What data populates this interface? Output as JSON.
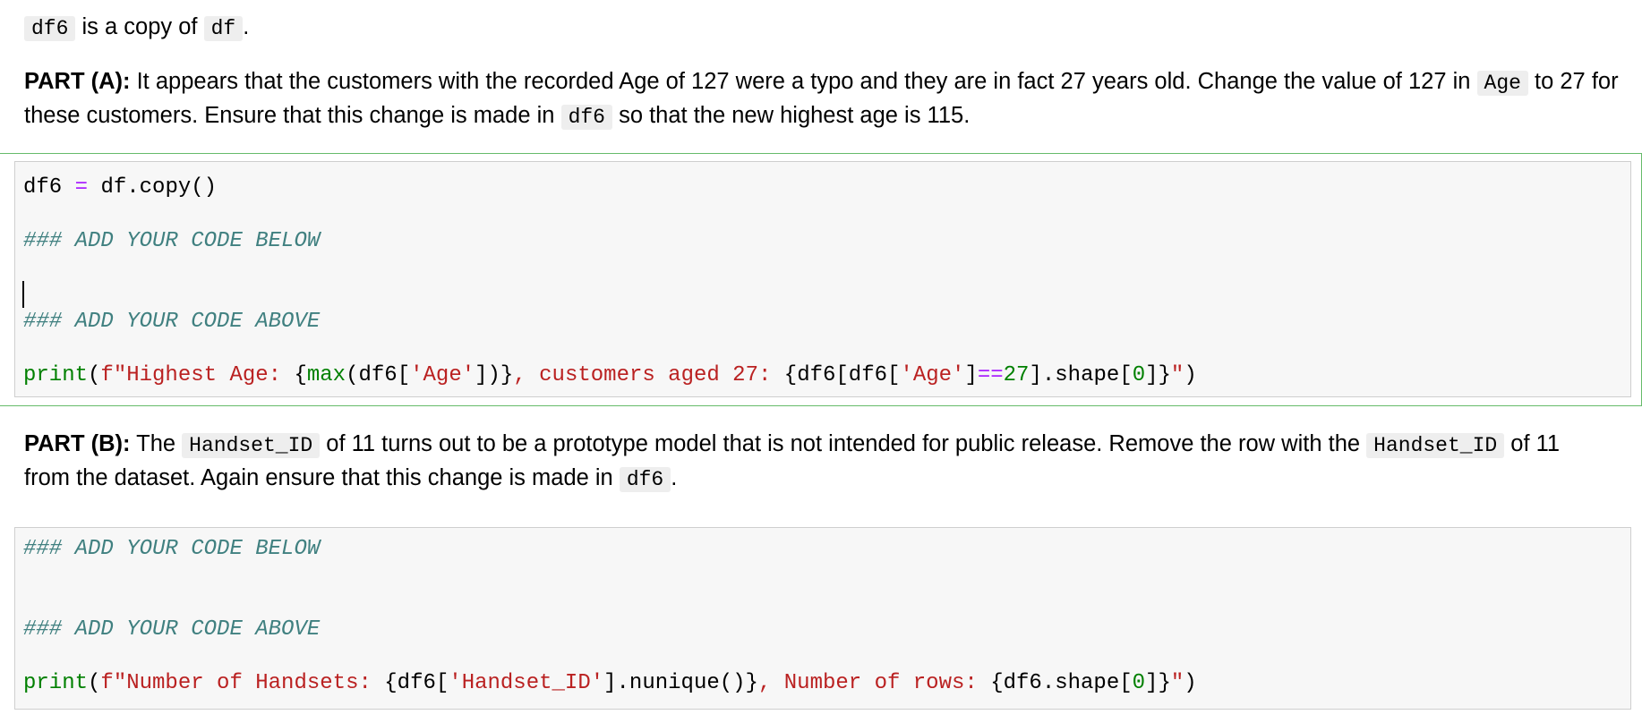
{
  "intro": {
    "code_a": "df6",
    "text": " is a copy of ",
    "code_b": "df",
    "end": "."
  },
  "part_a": {
    "label": "PART (A):",
    "text1": " It appears that the customers with the recorded Age of 127 were a typo and they are in fact 27 years old. Change the value of 127 in ",
    "code1": "Age",
    "text2": " to 27 for",
    "text3": "these customers. Ensure that this change is made in ",
    "code2": "df6",
    "text4": " so that the new highest age is 115."
  },
  "cell1": {
    "l1_var": "df6",
    "l1_op": "=",
    "l1_rest": "df.copy()",
    "l2": "### ADD YOUR CODE BELOW",
    "l3": "### ADD YOUR CODE ABOVE",
    "l4": {
      "fn": "print",
      "p1": "(",
      "s1": "f\"Highest Age: ",
      "b1": "{",
      "fn2": "max",
      "e1": "(df6[",
      "s2": "'Age'",
      "e2": "])}",
      "s3": ", customers aged 27: ",
      "e3": "{df6[df6[",
      "s4": "'Age'",
      "e4": "]",
      "op": "==",
      "n1": "27",
      "e5": "].shape[",
      "n2": "0",
      "e6": "]}",
      "s5": "\"",
      "p2": ")"
    }
  },
  "part_b": {
    "label": "PART (B):",
    "text1": " The ",
    "code1": "Handset_ID",
    "text2": " of 11 turns out to be a prototype model that is not intended for public release. Remove the row with the ",
    "code2": "Handset_ID",
    "text3": " of 11",
    "text4": "from the dataset. Again ensure that this change is made in ",
    "code3": "df6",
    "text5": "."
  },
  "cell2": {
    "l1": "### ADD YOUR CODE BELOW",
    "l2": "### ADD YOUR CODE ABOVE",
    "l3": {
      "fn": "print",
      "p1": "(",
      "s1": "f\"Number of Handsets: ",
      "e1": "{df6[",
      "s2": "'Handset_ID'",
      "e2": "].nunique()}",
      "s3": ", Number of rows: ",
      "e3": "{df6.shape[",
      "n1": "0",
      "e4": "]}",
      "s4": "\"",
      "p2": ")"
    }
  }
}
